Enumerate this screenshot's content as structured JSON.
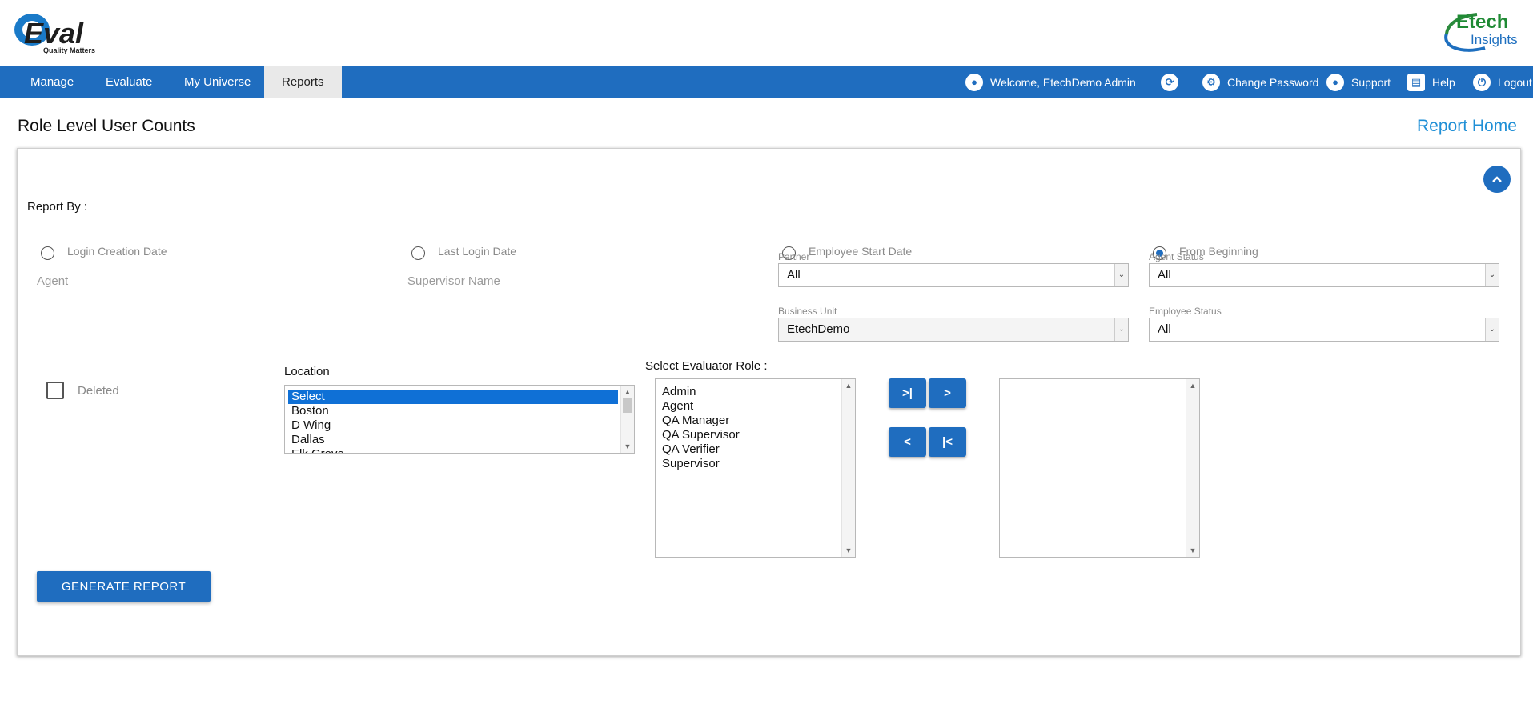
{
  "header": {
    "logo_text": "Q-Eval",
    "logo_tagline": "Quality Matters",
    "partner_logo_line1": "Etech",
    "partner_logo_line2": "Insights"
  },
  "nav": {
    "items": [
      {
        "label": "Manage",
        "icon": null
      },
      {
        "label": "Evaluate",
        "icon": null
      },
      {
        "label": "My Universe",
        "icon": null
      },
      {
        "label": "Reports",
        "icon": null
      }
    ],
    "active": "Reports",
    "welcome": "Welcome, EtechDemo Admin",
    "change_password": "Change Password",
    "support": "Support",
    "help": "Help",
    "logout": "Logout",
    "icons": {
      "welcome": "user-circle-icon",
      "sync": "sync-icon",
      "change_password": "gear-icon",
      "support": "support-icon",
      "help": "book-icon",
      "logout": "power-icon"
    },
    "bg_color": "#1f6dbf"
  },
  "page": {
    "title": "Role Level User Counts",
    "report_home": "Report Home"
  },
  "form": {
    "report_by_label": "Report By :",
    "radios": [
      {
        "label": "Login Creation Date",
        "checked": false
      },
      {
        "label": "Last Login Date",
        "checked": false
      },
      {
        "label": "Employee Start Date",
        "checked": false
      },
      {
        "label": "From Beginning",
        "checked": true
      }
    ],
    "agent_placeholder": "Agent",
    "supervisor_placeholder": "Supervisor Name",
    "partner": {
      "label": "Partner",
      "value": "All"
    },
    "agent_status": {
      "label": "Agent Status",
      "value": "All"
    },
    "business_unit": {
      "label": "Business Unit",
      "value": "EtechDemo"
    },
    "employee_status": {
      "label": "Employee Status",
      "value": "All"
    },
    "deleted_label": "Deleted",
    "location": {
      "label": "Location",
      "options": [
        "Select",
        "Boston",
        "D Wing",
        "Dallas",
        "Elk Grove"
      ],
      "selected": "Select"
    },
    "evaluator_role": {
      "label": "Select Evaluator Role :",
      "options": [
        "Admin",
        "Agent",
        "QA Manager",
        "QA Supervisor",
        "QA Verifier",
        "Supervisor"
      ],
      "selected_options": []
    },
    "move_buttons": {
      "move_all_right": ">|",
      "move_right": ">",
      "move_left": "<",
      "move_all_left": "|<"
    },
    "generate_button": "GENERATE REPORT",
    "accent_color": "#1f6dbf"
  }
}
